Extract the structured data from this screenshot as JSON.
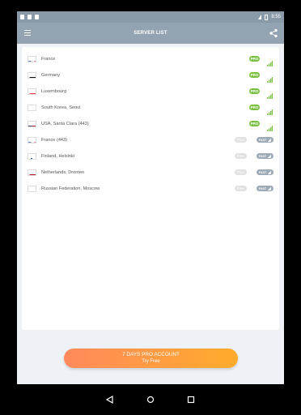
{
  "status_bar": {
    "time": "8:55",
    "icons": [
      "notification-icon",
      "sd-card-icon",
      "notification-icon",
      "wifi-icon",
      "battery-icon"
    ]
  },
  "toolbar": {
    "title": "SERVER LIST",
    "menu_icon": "hamburger-menu-icon",
    "share_icon": "share-icon"
  },
  "colors": {
    "toolbar": "#94a3b2",
    "pro_badge": "#7ac143",
    "free_badge": "#e2e2e2",
    "fast_badge": "#9eaab6",
    "cta_gradient_start": "#ff8a5c",
    "cta_gradient_end": "#ffab2b"
  },
  "servers": [
    {
      "name": "France",
      "flag": "france",
      "tier": "pro",
      "badge": "PRO"
    },
    {
      "name": "Germany",
      "flag": "germany",
      "tier": "pro",
      "badge": "PRO"
    },
    {
      "name": "Luxembourg",
      "flag": "luxembourg",
      "tier": "pro",
      "badge": "PRO"
    },
    {
      "name": "South Korea, Seoul",
      "flag": "south-korea",
      "tier": "pro",
      "badge": "PRO"
    },
    {
      "name": "USA, Santa Clara (443)",
      "flag": "usa",
      "tier": "pro",
      "badge": "PRO"
    },
    {
      "name": "France (443)",
      "flag": "france",
      "tier": "free",
      "badge": "Free",
      "speed": "FAST"
    },
    {
      "name": "Finland, Helsinki",
      "flag": "finland",
      "tier": "free",
      "badge": "Free",
      "speed": "FAST"
    },
    {
      "name": "Netherlands, Dronten",
      "flag": "netherlands",
      "tier": "free",
      "badge": "Free",
      "speed": "FAST"
    },
    {
      "name": "Russian Federation, Moscow",
      "flag": "russia",
      "tier": "free",
      "badge": "Free",
      "speed": "FAST"
    }
  ],
  "cta": {
    "line1": "7 DAYS PRO ACCOUNT",
    "line2": "Try Free"
  },
  "nav_bar": {
    "icons": [
      "back-icon",
      "home-icon",
      "recents-icon"
    ]
  }
}
